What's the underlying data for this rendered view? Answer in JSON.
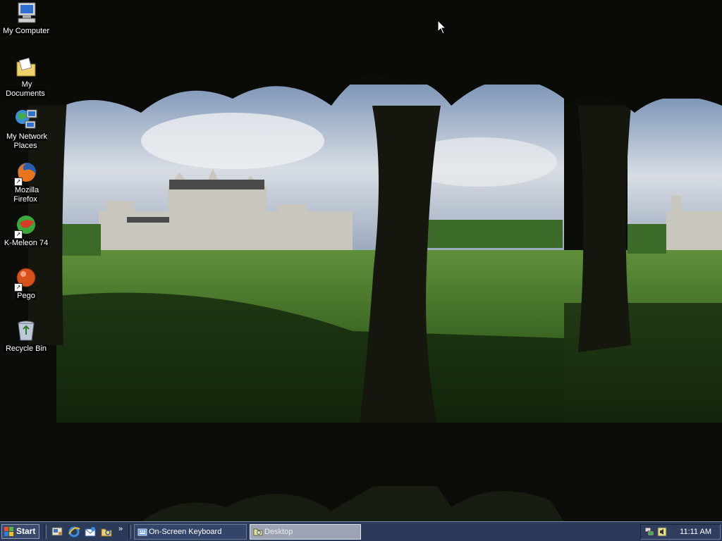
{
  "desktop": {
    "icons": [
      {
        "label": "My Computer",
        "icon": "my-computer-icon"
      },
      {
        "label": "My Documents",
        "icon": "my-documents-icon"
      },
      {
        "label": "My Network Places",
        "icon": "network-places-icon"
      },
      {
        "label": "Mozilla Firefox",
        "icon": "firefox-icon"
      },
      {
        "label": "K-Meleon 74",
        "icon": "k-meleon-icon"
      },
      {
        "label": "Pego",
        "icon": "pego-icon"
      },
      {
        "label": "Recycle Bin",
        "icon": "recycle-bin-icon"
      }
    ]
  },
  "taskbar": {
    "start_label": "Start",
    "quick_launch": [
      "show-desktop-icon",
      "internet-explorer-icon",
      "outlook-express-icon",
      "explorer-icon"
    ],
    "chevron": "»",
    "tasks": [
      {
        "label": "On-Screen Keyboard",
        "icon": "keyboard-icon",
        "active": false
      },
      {
        "label": "Desktop",
        "icon": "folder-icon",
        "active": true
      }
    ],
    "tray_icons": [
      "network-icon",
      "volume-icon"
    ],
    "clock": "11:11 AM"
  }
}
